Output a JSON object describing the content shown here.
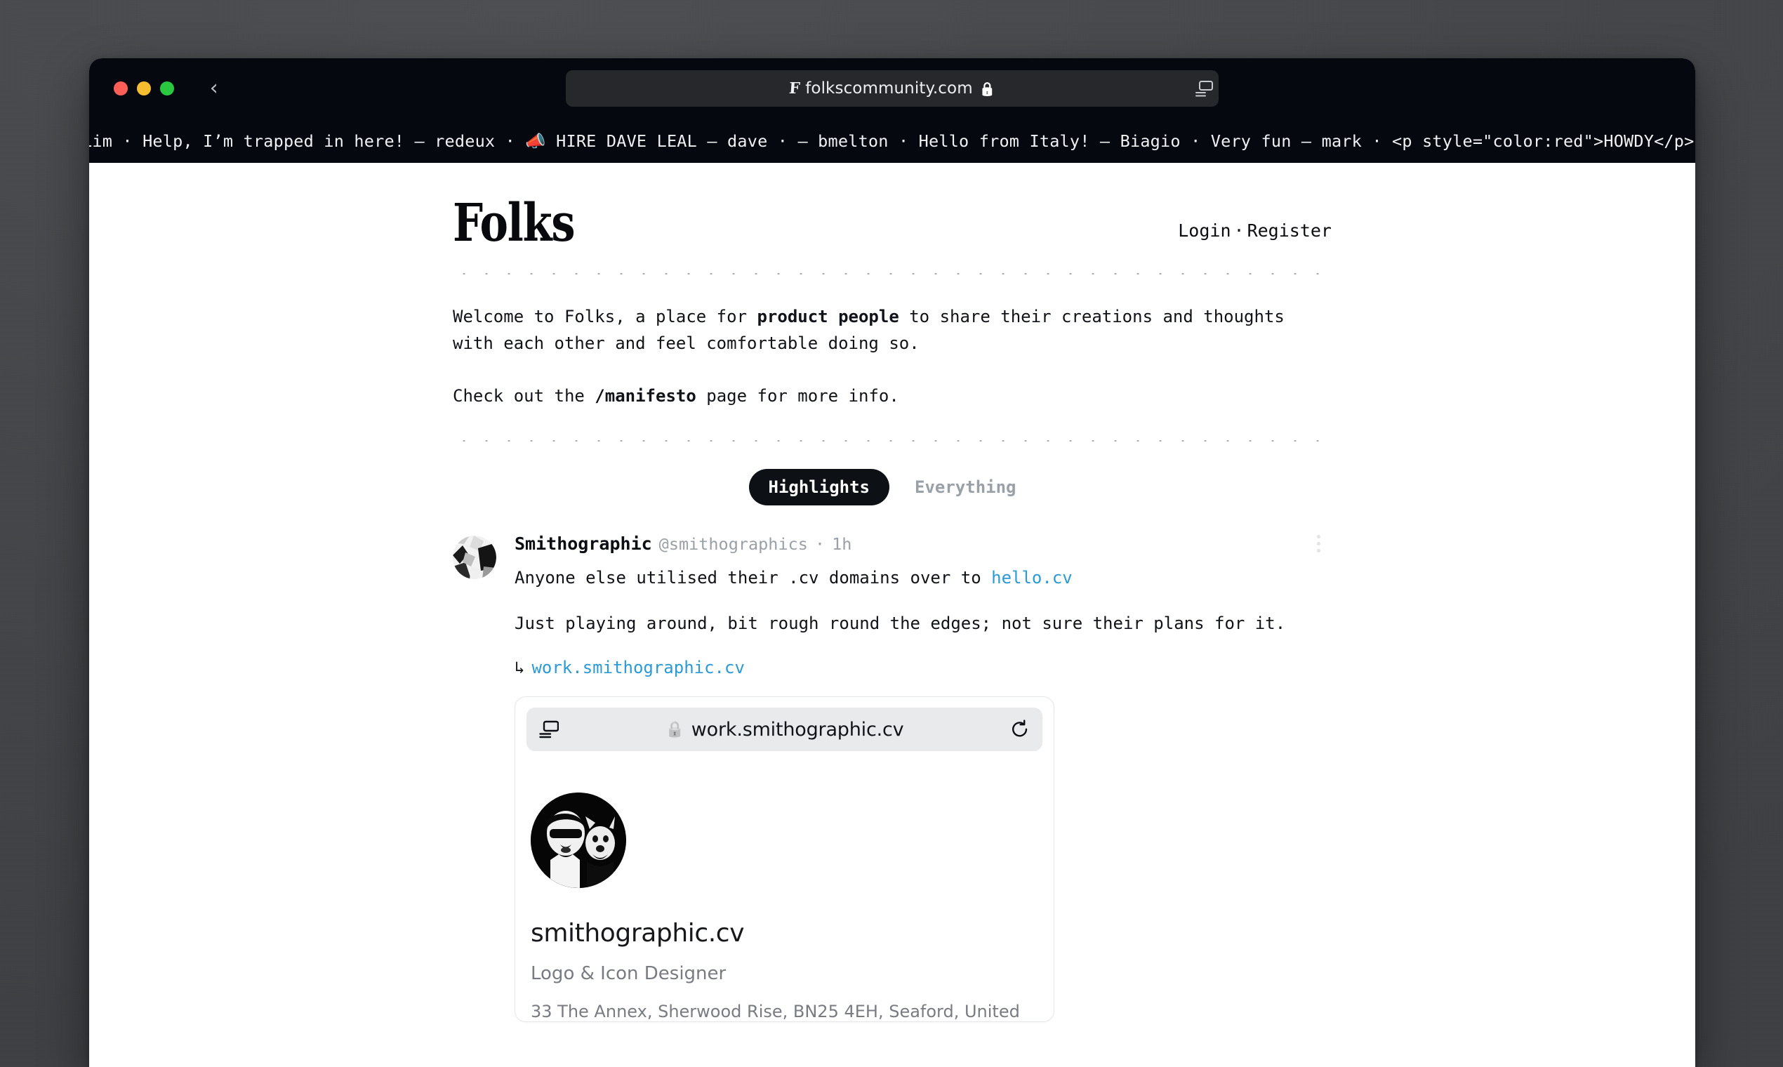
{
  "browser": {
    "traffic_lights": [
      "close",
      "minimize",
      "maximize"
    ],
    "back_label": "‹",
    "favicon_letter": "F",
    "url": "folkscommunity.com",
    "lock": "🔒",
    "sidebar_icon": "sidebar-icon"
  },
  "ticker": {
    "items": [
      {
        "text": "Lim",
        "sep": "·"
      },
      {
        "text": "Help, I’m trapped in here! — redeux",
        "sep": "·"
      },
      {
        "text": "📣 HIRE DAVE LEAL — dave",
        "sep": "·"
      },
      {
        "text": "— bmelton",
        "sep": "·"
      },
      {
        "text": "Hello from Italy! — Biagio",
        "sep": "·"
      },
      {
        "text": "Very fun — mark",
        "sep": "·"
      },
      {
        "text": "<p style=\"color:red\">HOWDY</p> — Nick Noble",
        "sep": "·"
      }
    ],
    "full_text": "Lim · Help, I’m trapped in here! — redeux · 📣 HIRE DAVE LEAL — dave · — bmelton · Hello from Italy! — Biagio · Very fun — mark · <p style=\"color:red\">HOWDY</p> — Nick Noble ·"
  },
  "site": {
    "logo": "Folks",
    "login_label": "Login",
    "separator": "·",
    "register_label": "Register",
    "intro_line1_a": "Welcome to Folks, a place for ",
    "intro_line1_b": "product people",
    "intro_line1_c": " to share their creations and thoughts with each other and feel comfortable doing so.",
    "intro_line2_a": "Check out the ",
    "intro_line2_b": "/manifesto",
    "intro_line2_c": " page for more info."
  },
  "tabs": [
    {
      "label": "Highlights",
      "active": true
    },
    {
      "label": "Everything",
      "active": false
    }
  ],
  "post": {
    "author": "Smithographic",
    "handle": "@smithographics",
    "time_separator": "·",
    "time": "1h",
    "body_1_a": "Anyone else utilised their .cv domains over to ",
    "body_1_link": "hello.cv",
    "body_2": "Just playing around, bit rough round the edges; not sure their plans for it.",
    "reply_arrow": "↳",
    "reply_link": "work.smithographic.cv",
    "menu_icon": "kebab-menu-icon"
  },
  "embed": {
    "lock": "🔒",
    "url": "work.smithographic.cv",
    "reader_icon": "reader-view-icon",
    "reload_icon": "reload-icon",
    "site_title": "smithographic.cv",
    "site_role": "Logo & Icon Designer",
    "site_address": "33 The Annex, Sherwood Rise, BN25 4EH, Seaford, United"
  },
  "colors": {
    "chrome_bg": "#060810",
    "link": "#2b9ad6",
    "tab_active_bg": "#0d1015",
    "muted": "#9aa0a8",
    "desktop": "#46484b"
  }
}
